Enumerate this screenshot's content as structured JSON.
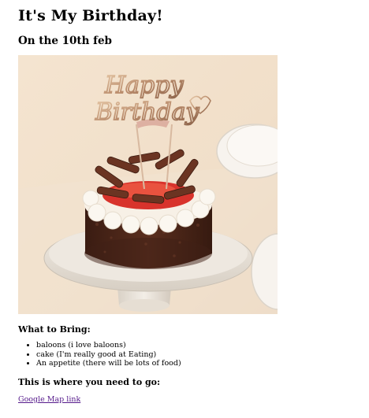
{
  "page": {
    "title": "It's My Birthday!",
    "subtitle": "On the 10th feb",
    "photo": {
      "topper_text_line1": "Happy",
      "topper_text_line2": "Birthday"
    },
    "bring": {
      "heading": "What to Bring:",
      "items": [
        "baloons (i love baloons)",
        "cake (I'm really good at Eating)",
        "An appetite (there will be lots of food)"
      ]
    },
    "location": {
      "heading": "This is where you need to go:",
      "link_text": "Google Map link"
    }
  },
  "colors": {
    "link": "#551a8b",
    "background": "#ffffff"
  }
}
